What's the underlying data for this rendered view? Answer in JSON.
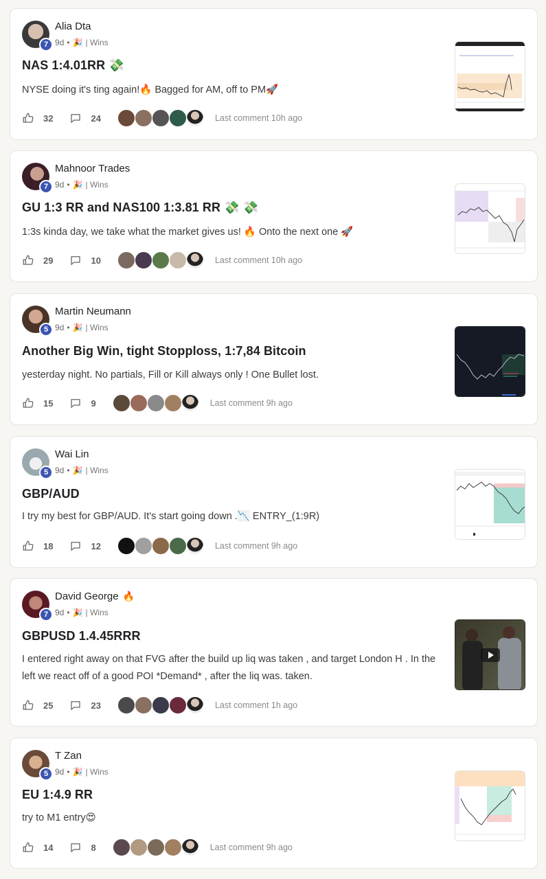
{
  "posts": [
    {
      "author": "Alia Dta",
      "level": "7",
      "time": "9d",
      "category": "| Wins",
      "title": "NAS 1:4.01RR 💸",
      "body": "NYSE doing it's ting again!🔥 Bagged for AM, off to PM🚀",
      "likes": "32",
      "comments": "24",
      "last_comment": "Last comment 10h ago",
      "avatar_color": "#3a3a3a",
      "commenter_colors": [
        "#6b4a3a",
        "#8a7060",
        "#555555",
        "#2f5b4a",
        "#e8e8e8"
      ]
    },
    {
      "author": "Mahnoor Trades",
      "level": "7",
      "time": "9d",
      "category": "| Wins",
      "title": "GU 1:3 RR and NAS100 1:3.81 RR 💸 💸",
      "body": "1:3s kinda day, we take what the market gives us! 🔥 Onto the next one 🚀",
      "likes": "29",
      "comments": "10",
      "last_comment": "Last comment 10h ago",
      "avatar_color": "#4a2a35",
      "commenter_colors": [
        "#7a6a60",
        "#4a3a50",
        "#5a7a4a",
        "#c9b9a9",
        "#e8e8e8"
      ]
    },
    {
      "author": "Martin Neumann",
      "level": "5",
      "time": "9d",
      "category": "| Wins",
      "title": "Another Big Win, tight Stopploss, 1:7,84 Bitcoin",
      "body": "yesterday night. No partials, Fill or Kill always only ! One Bullet lost.",
      "likes": "15",
      "comments": "9",
      "last_comment": "Last comment 9h ago",
      "avatar_color": "#6a4a3a",
      "commenter_colors": [
        "#5a4a3a",
        "#9a6a5a",
        "#8a8a8a",
        "#a08060",
        "#e8e8e8"
      ]
    },
    {
      "author": "Wai Lin",
      "level": "5",
      "time": "9d",
      "category": "| Wins",
      "title": "GBP/AUD",
      "body": "I try my best for GBP/AUD. It's start going down .📉 ENTRY_(1:9R)",
      "likes": "18",
      "comments": "12",
      "last_comment": "Last comment 9h ago",
      "avatar_color": "#b9c4cc",
      "commenter_colors": [
        "#111111",
        "#a0a0a0",
        "#8a6a4a",
        "#4a6a4a",
        "#e8e8e8"
      ]
    },
    {
      "author": "David George",
      "author_emoji": "🔥",
      "level": "7",
      "time": "9d",
      "category": "| Wins",
      "title": "GBPUSD 1.4.45RRR",
      "body": "I entered right away on that FVG after the build up liq was taken , and target London H . In the left we react off of a good POI *Demand* , after the liq was. taken.",
      "likes": "25",
      "comments": "23",
      "last_comment": "Last comment 1h ago",
      "avatar_color": "#7a2a2a",
      "commenter_colors": [
        "#4a4a4a",
        "#8a7060",
        "#3a3a4a",
        "#6a2a3a",
        "#e8e8e8"
      ]
    },
    {
      "author": "T Zan",
      "level": "5",
      "time": "9d",
      "category": "| Wins",
      "title": "EU 1:4.9 RR",
      "body": "try to M1 entry😍",
      "likes": "14",
      "comments": "8",
      "last_comment": "Last comment 9h ago",
      "avatar_color": "#c9a080",
      "commenter_colors": [
        "#5a4a50",
        "#b09a80",
        "#7a6a5a",
        "#a08060",
        "#e8e8e8"
      ]
    }
  ],
  "icons": {
    "separator": "•",
    "party": "🎉",
    "like": "thumbs-up-icon",
    "comment": "comment-bubble-icon",
    "play": "play-icon"
  }
}
